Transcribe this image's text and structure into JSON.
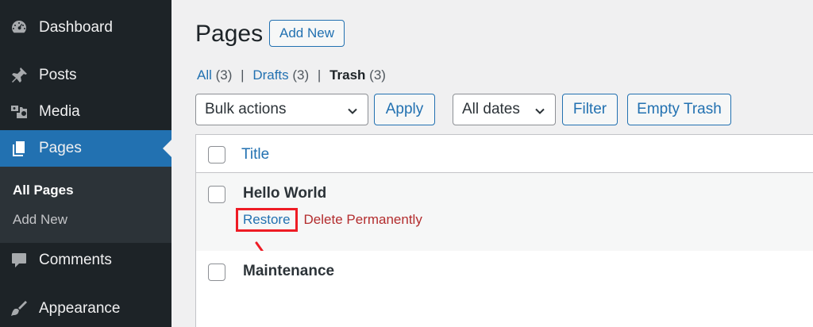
{
  "sidebar": {
    "items": [
      {
        "label": "Dashboard",
        "icon": "dashboard-icon"
      },
      {
        "label": "Posts",
        "icon": "pin-icon"
      },
      {
        "label": "Media",
        "icon": "media-icon"
      },
      {
        "label": "Pages",
        "icon": "pages-icon"
      },
      {
        "label": "Comments",
        "icon": "comment-icon"
      },
      {
        "label": "Appearance",
        "icon": "brush-icon"
      }
    ],
    "submenu": [
      "All Pages",
      "Add New"
    ],
    "accent_color": "#2271b1",
    "background_color": "#1d2327"
  },
  "header": {
    "title": "Pages",
    "add_new_label": "Add New"
  },
  "views": {
    "all_label": "All",
    "all_count": "(3)",
    "drafts_label": "Drafts",
    "drafts_count": "(3)",
    "trash_label": "Trash",
    "trash_count": "(3)",
    "separator": "|"
  },
  "toolbar": {
    "bulk_actions_value": "Bulk actions",
    "apply_label": "Apply",
    "dates_value": "All dates",
    "filter_label": "Filter",
    "empty_trash_label": "Empty Trash"
  },
  "table": {
    "columns": [
      "Title"
    ],
    "rows": [
      {
        "title": "Hello World",
        "actions": [
          "Restore",
          "Delete Permanently"
        ]
      },
      {
        "title": "Maintenance"
      }
    ]
  },
  "annotation": {
    "highlight_color": "#ee1c25"
  }
}
